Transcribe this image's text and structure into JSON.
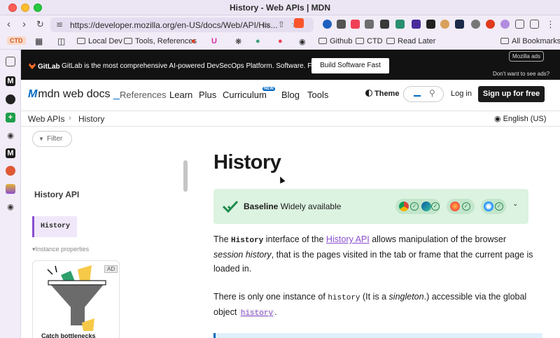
{
  "window": {
    "title": "History - Web APIs | MDN"
  },
  "address_bar": {
    "url": "https://developer.mozilla.org/en-US/docs/Web/API/His..."
  },
  "bookmarks": {
    "ctd_badge": "CTD",
    "items": [
      "Local Dev",
      "Tools, References",
      "Github",
      "CTD",
      "Read Later",
      "All Bookmarks"
    ]
  },
  "ad": {
    "brand": "GitLab",
    "text": "GitLab is the most comprehensive AI-powered DevSecOps Platform. Software. Faster.",
    "cta": "Build Software Fast",
    "mozilla_ads": "Mozilla ads",
    "dont_want": "Don't want to see ads?"
  },
  "mdn_header": {
    "logo": "mdn web docs",
    "nav": [
      "References",
      "Learn",
      "Plus",
      "Curriculum",
      "Blog",
      "Tools"
    ],
    "new_badge": "NEW",
    "theme": "Theme",
    "login": "Log in",
    "signup": "Sign up for free"
  },
  "breadcrumb": {
    "items": [
      "Web APIs",
      "History"
    ],
    "language": "English (US)"
  },
  "sidebar": {
    "filter_placeholder": "Filter",
    "heading": "History API",
    "current": "History",
    "section": "Instance properties",
    "ad_badge": "AD",
    "ad_caption": "Catch bottlenecks"
  },
  "article": {
    "title": "History",
    "baseline_label": "Baseline",
    "baseline_status": "Widely available",
    "p1_the": "The",
    "p1_code": "History",
    "p1_mid": "interface of the",
    "p1_link": "History API",
    "p1_rest_1": "allows manipulation of the browser",
    "p1_em": "session history",
    "p1_rest_2": ", that is the pages visited in the tab or frame that the current page is loaded in.",
    "p2_start": "There is only one instance of",
    "p2_code": "history",
    "p2_mid_1": "(It is a",
    "p2_em": "singleton",
    "p2_mid_2": ".) accessible via the global object",
    "p2_code_link": "history",
    "p2_end": "."
  },
  "colors": {
    "accent": "#0069c2",
    "baseline_bg": "#dcf3e1",
    "sidebar_current": "#8a4fd1",
    "ad_bg": "#121212"
  }
}
